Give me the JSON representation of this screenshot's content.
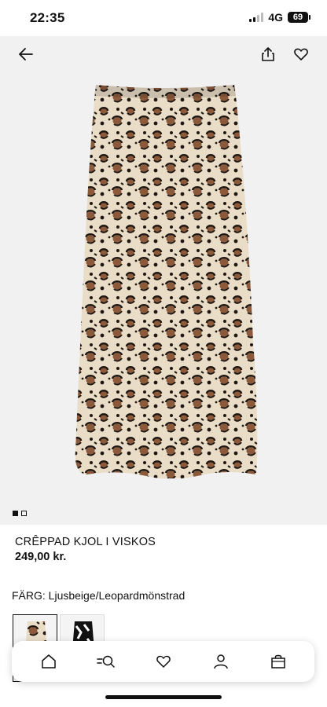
{
  "status_bar": {
    "time": "22:35",
    "network": "4G",
    "battery": "69"
  },
  "nav": {
    "back_icon": "arrow-left-icon",
    "share_icon": "share-icon",
    "favorite_icon": "heart-icon"
  },
  "gallery": {
    "image": "leopard-print-skirt",
    "pages": 2,
    "active_page": 1
  },
  "product": {
    "name": "CRÊPPAD KJOL I VISKOS",
    "price": "249,00 kr."
  },
  "color": {
    "label": "FÄRG: Ljusbeige/Leopardmönstrad",
    "swatches": [
      "leopard-swatch",
      "black-white-print-swatch"
    ],
    "selected": 0
  },
  "tab_bar": {
    "items": [
      "home-icon",
      "search-icon",
      "heart-icon",
      "user-icon",
      "bag-icon"
    ]
  },
  "colors": {
    "background": "#ffffff",
    "image_bg": "#f1f1f1",
    "text": "#111111",
    "leopard_base": "#e9ddc7",
    "leopard_spot": "#1e1712",
    "leopard_tan": "#8c5a3a"
  }
}
